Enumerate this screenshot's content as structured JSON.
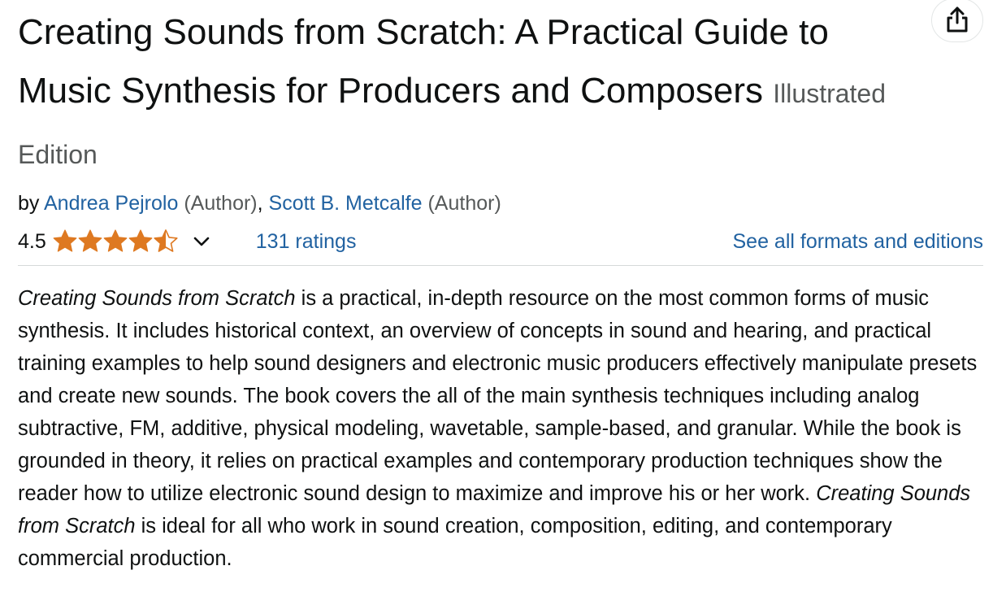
{
  "product": {
    "title": "Creating Sounds from Scratch: A Practical Guide to Music Synthesis for Producers and Composers",
    "edition": "Illustrated Edition"
  },
  "byline": {
    "prefix": "by",
    "authors": [
      {
        "name": "Andrea Pejrolo",
        "role": "(Author)",
        "separator": ","
      },
      {
        "name": "Scott B. Metcalfe",
        "role": "(Author)",
        "separator": ""
      }
    ]
  },
  "rating": {
    "value": "4.5",
    "stars": 4.5,
    "ratings_count_label": "131 ratings",
    "formats_label": "See all formats and editions"
  },
  "description": {
    "title_italic_1": "Creating Sounds from Scratch",
    "text_1": " is a practical, in-depth resource on the most common forms of music synthesis. It includes historical context, an overview of concepts in sound and hearing, and practical training examples to help sound designers and electronic music producers effectively manipulate presets and create new sounds. The book covers the all of the main synthesis techniques including analog subtractive, FM, additive, physical modeling, wavetable, sample-based, and granular. While the book is grounded in theory, it relies on practical examples and contemporary production techniques show the reader how to utilize electronic sound design to maximize and improve his or her work. ",
    "title_italic_2": "Creating Sounds from Scratch",
    "text_2": " is ideal for all who work in sound creation, composition, editing, and contemporary commercial production."
  },
  "colors": {
    "star": "#de7921",
    "link": "#2162a1",
    "muted": "#565959"
  },
  "icons": {
    "share": "share-icon",
    "chevron": "chevron-down-icon"
  }
}
